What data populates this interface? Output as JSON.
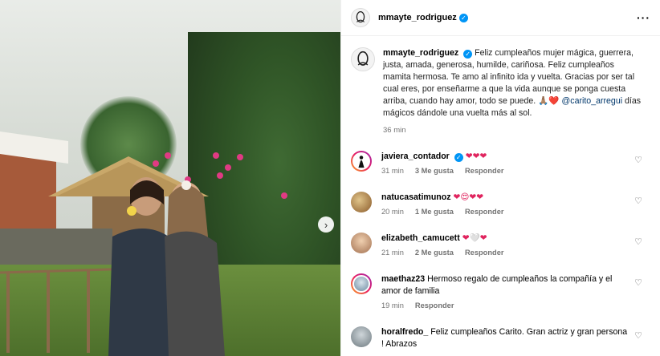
{
  "post": {
    "username": "mmayte_rodriguez",
    "more_icon": "more-horizontal-icon",
    "verified_icon": "verified-badge-icon"
  },
  "caption": {
    "username": "mmayte_rodriguez",
    "text": "Feliz cumpleaños mujer mágica, guerrera, justa, amada, generosa, humilde, cariñosa. Feliz cumpleaños mamita hermosa. Te amo al infinito ida y vuelta. Gracias por ser tal cual eres, por enseñarme a que la vida aunque se ponga cuesta arriba, cuando hay amor, todo se puede.",
    "emojis": "🙏🏽❤️",
    "mention": "@carito_arregui",
    "text_after": "días mágicos dándole una vuelta más al sol.",
    "time": "36 min"
  },
  "comments": [
    {
      "username": "javiera_contador",
      "text": "❤❤❤",
      "time": "31 min",
      "likes": "3 Me gusta",
      "reply": "Responder"
    },
    {
      "username": "natucasatimunoz",
      "text": "❤😍❤❤",
      "time": "20 min",
      "likes": "1 Me gusta",
      "reply": "Responder"
    },
    {
      "username": "elizabeth_camucett",
      "text": "❤🤍❤",
      "time": "21 min",
      "likes": "2 Me gusta",
      "reply": "Responder"
    },
    {
      "username": "maethaz23",
      "text": "Hermoso regalo de cumpleaños la compañía y el amor de familia",
      "time": "19 min",
      "likes": "",
      "reply": "Responder"
    },
    {
      "username": "horalfredo_",
      "text": "Feliz cumpleaños Carito. Gran actriz y gran persona ! Abrazos",
      "time": "",
      "likes": "",
      "reply": ""
    }
  ],
  "media": {
    "next_icon": "chevron-right-icon"
  }
}
